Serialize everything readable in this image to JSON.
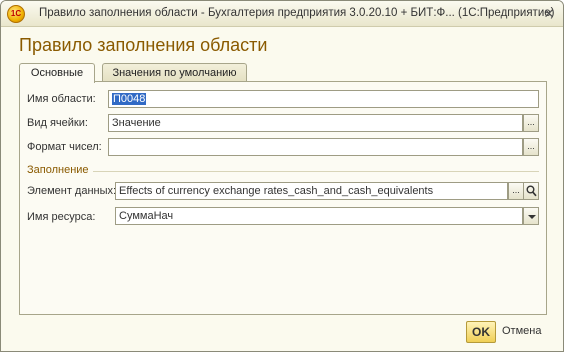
{
  "window": {
    "title": "Правило заполнения области - Бухгалтерия предприятия 3.0.20.10 + БИТ:Ф...  (1С:Предприятие)",
    "app_icon_text": "1С"
  },
  "form": {
    "title": "Правило заполнения области"
  },
  "tabs": [
    {
      "label": "Основные",
      "active": true
    },
    {
      "label": "Значения по умолчанию",
      "active": false
    }
  ],
  "fields": {
    "area_name": {
      "label": "Имя области:",
      "value": "П0048"
    },
    "cell_type": {
      "label": "Вид ячейки:",
      "value": "Значение"
    },
    "number_format": {
      "label": "Формат чисел:",
      "value": ""
    },
    "filling_group": {
      "label": "Заполнение"
    },
    "data_element": {
      "label": "Элемент данных:",
      "value": "Effects of currency exchange rates_cash_and_cash_equivalents"
    },
    "resource_name": {
      "label": "Имя ресурса:",
      "value": "СуммаНач"
    }
  },
  "buttons": {
    "ellipsis": "...",
    "ok": "OK",
    "cancel": "Отмена"
  },
  "colors": {
    "window_bg": "#fbfaee",
    "title_accent": "#8a5a00",
    "ok_button": "#f0cf56",
    "selection": "#316ac5"
  }
}
